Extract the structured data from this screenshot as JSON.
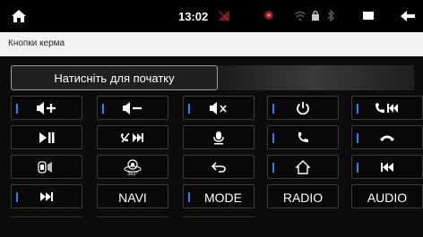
{
  "status": {
    "time": "13:02"
  },
  "header": {
    "title": "Кнопки керма"
  },
  "start": {
    "label": "Натисніть для початку"
  },
  "keys": {
    "r4c2": "NAVI",
    "r4c3": "MODE",
    "r4c4": "RADIO",
    "r4c5": "AUDIO"
  },
  "colors": {
    "accent": "#2a7fff",
    "header_bg": "#f3f3f3"
  },
  "icons": [
    "home-icon",
    "volume-up-icon",
    "volume-down-icon",
    "mute-icon",
    "power-icon",
    "call-prev-icon",
    "play-pause-icon",
    "hangup-next-icon",
    "mic-icon",
    "phone-icon",
    "hangup-icon",
    "car-speaker-icon",
    "camera-360-icon",
    "return-icon",
    "home-outline-icon",
    "prev-track-icon",
    "next-track-icon"
  ]
}
